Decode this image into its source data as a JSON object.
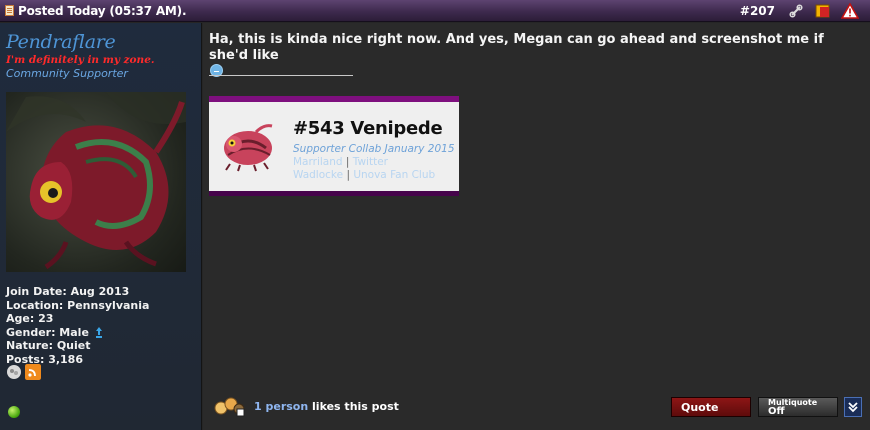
{
  "header": {
    "date_text": "Posted Today (05:37 AM).",
    "post_number": "#207",
    "icons": [
      "link-icon",
      "report-icon",
      "warning-icon"
    ]
  },
  "user": {
    "username": "Pendraflare",
    "user_title": "I'm definitely in my zone.",
    "rank": "Community Supporter",
    "stats": {
      "join_date": "Join Date: Aug 2013",
      "location": "Location: Pennsylvania",
      "age": "Age: 23",
      "gender": "Gender: Male",
      "nature": "Nature: Quiet",
      "posts": "Posts: 3,186"
    },
    "gender_icon": "male-icon",
    "online_status_icon": "online-status-icon"
  },
  "post": {
    "message": "Ha, this is kinda nice right now. And yes, Megan can go ahead and screenshot me if she'd like",
    "signature": {
      "title": "#543 Venipede",
      "subtitle": "Supporter Collab January 2015",
      "links_row1": [
        "Marriland",
        "Twitter"
      ],
      "links_row2": [
        "Wadlocke",
        "Unova Fan Club"
      ],
      "separator": "|"
    },
    "likes": {
      "count_link": "1 person",
      "text": "likes this post"
    }
  },
  "actions": {
    "quote_label": "Quote",
    "multiquote_label": "Multiquote",
    "multiquote_state": "Off"
  },
  "colors": {
    "username": "#4e95d6",
    "user_title": "#ff2a2a",
    "header_bg": "#3e2a4e",
    "sig_border": "#7e0f7e",
    "quote_button": "#7a1111"
  }
}
